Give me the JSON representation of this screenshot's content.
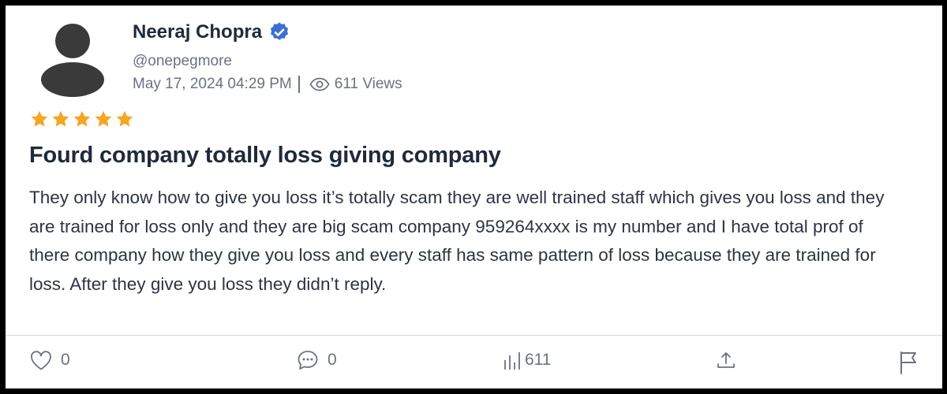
{
  "post": {
    "author": {
      "name": "Neeraj Chopra",
      "handle": "@onepegmore",
      "verified": true
    },
    "date": "May 17, 2024 04:29 PM",
    "views": "611 Views",
    "rating": 5,
    "title": "Fourd company totally loss giving company",
    "body": "They only know how to give you loss it’s totally scam they are well trained staff which gives you loss and they are trained for loss only and they are big scam company 959264xxxx is my number and I have total prof of there company how they give you loss and every staff has same pattern of loss because they are trained for loss. After they give you loss they didn’t reply."
  },
  "actions": {
    "likes": "0",
    "comments": "0",
    "views": "611"
  },
  "colors": {
    "star": "#f5a623",
    "verified": "#3b6fd4",
    "text_dark": "#1f2a3a",
    "muted": "#6b7280"
  },
  "icons": [
    "avatar-icon",
    "verified-badge-icon",
    "eye-icon",
    "star-icon",
    "heart-icon",
    "comment-icon",
    "bar-chart-icon",
    "share-icon",
    "flag-icon"
  ]
}
